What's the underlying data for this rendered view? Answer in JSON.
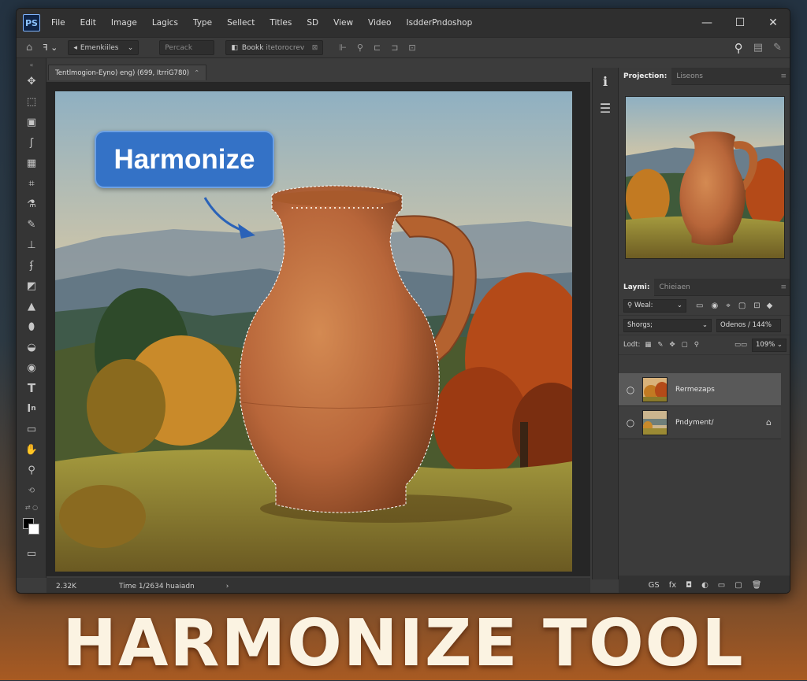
{
  "app": {
    "logo": "PS",
    "menus": [
      "File",
      "Edit",
      "Image",
      "Lagics",
      "Type",
      "Sellect",
      "Titles",
      "SD",
      "View",
      "Video",
      "IsdderPndoshop"
    ],
    "window_controls": [
      "—",
      "☐",
      "✕"
    ]
  },
  "options": {
    "tool_label": "Emenkiiles",
    "field_placeholder": "Percack",
    "book_label": "Bookk",
    "book_value": "itetorocrev"
  },
  "document": {
    "tab_title": "Tentlmogion-Eyno) eng) (699, ItrriG780)",
    "callout": "Harmonize"
  },
  "status": {
    "zoom": "2.32K",
    "info": "Time  1/2634 huaiadn"
  },
  "right_panel": {
    "tabs": [
      {
        "label": "Projection:",
        "active": true
      },
      {
        "label": "Liseons",
        "active": false
      }
    ],
    "layers_tabs": [
      {
        "label": "Laymi:",
        "active": true
      },
      {
        "label": "Chieiaen",
        "active": false
      }
    ],
    "kind_filter": "Weal:",
    "blend_mode": "Shorgs;",
    "opacity_label": "Odenos / 144%",
    "lock_label": "Lodt:",
    "fill_value": "109%",
    "layers": [
      {
        "name": "Rermezaps",
        "selected": true
      },
      {
        "name": "Pndyment/",
        "selected": false,
        "locked": true
      }
    ],
    "footer_icons": [
      "GS",
      "fx",
      "◘",
      "◐",
      "▭",
      "▢",
      "🗑"
    ]
  },
  "banner": {
    "title": "HARMONIZE TOOL"
  },
  "colors": {
    "accent": "#3472c6",
    "banner_text": "#fbf3e2",
    "ui_dark": "#2f2f2f"
  }
}
